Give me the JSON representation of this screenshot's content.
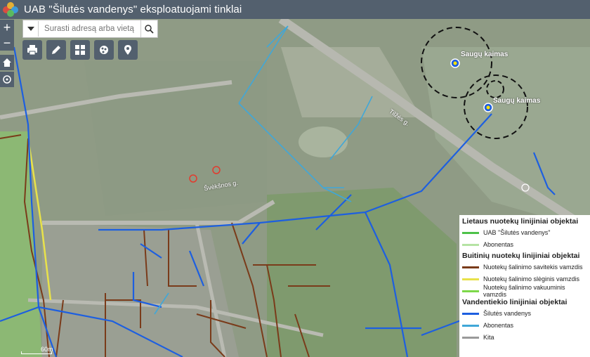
{
  "app": {
    "title": "UAB \"Šilutės vandenys\" eksploatuojami tinklai"
  },
  "zoom": {
    "in": "+",
    "out": "−"
  },
  "search": {
    "placeholder": "Surasti adresą arba vietą"
  },
  "tools": [
    {
      "name": "print-icon"
    },
    {
      "name": "draw-icon"
    },
    {
      "name": "basemap-icon"
    },
    {
      "name": "layers-icon"
    },
    {
      "name": "locate-icon"
    }
  ],
  "map_labels": {
    "saugu1": "Saugų kaimas",
    "saugu2": "Saugų kaimas",
    "tilzes": "Tilžės g.",
    "svencia": "Švėkšnos g.",
    "scale": "60m"
  },
  "legend": {
    "group1": "Lietaus nuotekų linijiniai objektai",
    "g1_item1": "UAB \"Šilutės vandenys\"",
    "g1_item2": "Abonentas",
    "group2": "Buitinių nuotekų linijiniai objektai",
    "g2_item1": "Nuotekų šalinimo savitekis vamzdis",
    "g2_item2": "Nuotekų šalinimo slėginis vamzdis",
    "g2_item3": "Nuotekų šalinimo vakuuminis vamzdis",
    "group3": "Vandentiekio linijiniai objektai",
    "g3_item1": "Šilutės vandenys",
    "g3_item2": "Abonentas",
    "g3_item3": "Kita"
  },
  "colors": {
    "storm_uab": "#4ec24a",
    "storm_abon": "#b5e3a4",
    "sewer_gravity": "#7a3b1a",
    "sewer_pressure": "#e8e24a",
    "sewer_vacuum": "#7dd84a",
    "water_main": "#1d5fe0",
    "water_abon": "#40a7d8",
    "water_other": "#9a9a9a"
  }
}
